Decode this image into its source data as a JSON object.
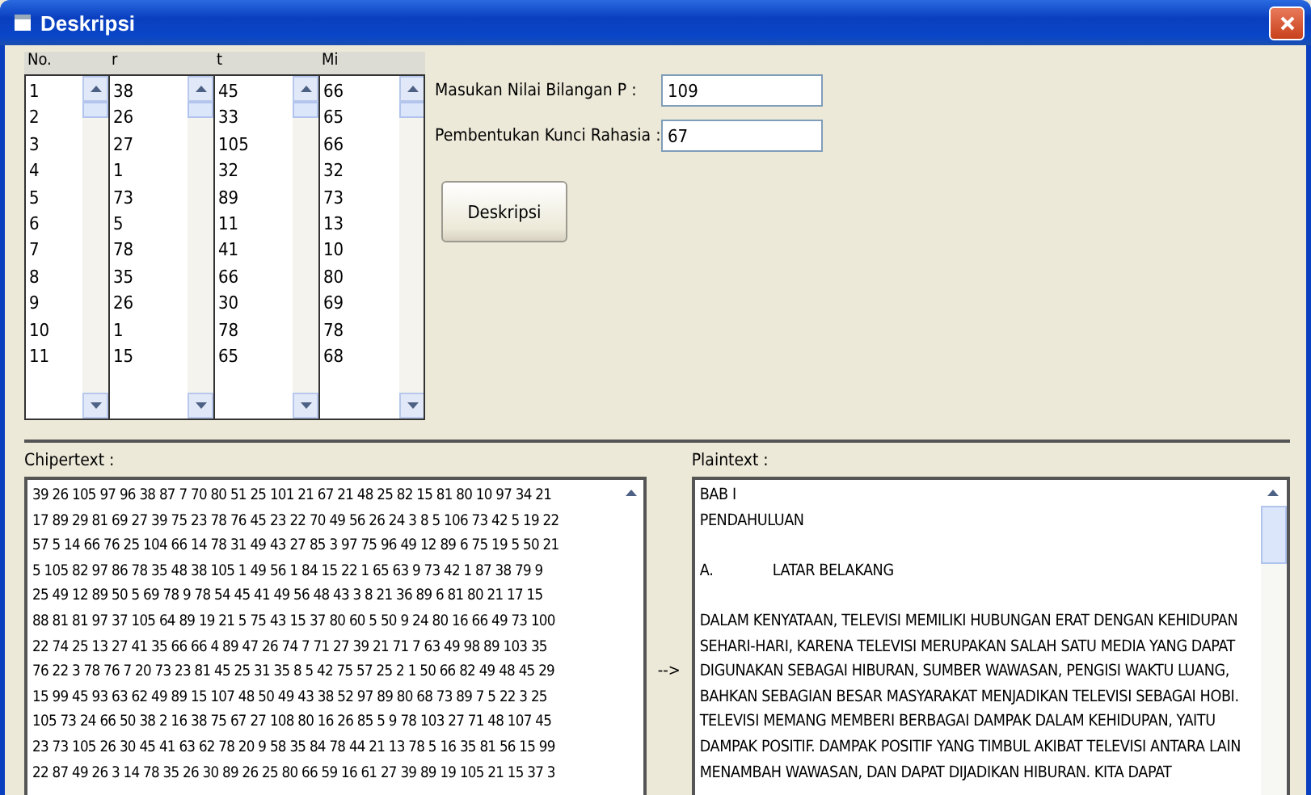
{
  "window": {
    "title": "Deskripsi"
  },
  "table": {
    "columns": [
      {
        "header": "No.",
        "values": [
          "1",
          "2",
          "3",
          "4",
          "5",
          "6",
          "7",
          "8",
          "9",
          "10",
          "11"
        ]
      },
      {
        "header": "r",
        "values": [
          "38",
          "26",
          "27",
          "1",
          "73",
          "5",
          "78",
          "35",
          "26",
          "1",
          "15"
        ]
      },
      {
        "header": "t",
        "values": [
          "45",
          "33",
          "105",
          "32",
          "89",
          "11",
          "41",
          "66",
          "30",
          "78",
          "65"
        ]
      },
      {
        "header": "Mi",
        "values": [
          "66",
          "65",
          "66",
          "32",
          "73",
          "13",
          "10",
          "80",
          "69",
          "78",
          "68"
        ]
      }
    ]
  },
  "fields": [
    {
      "label": "Masukan Nilai Bilangan P :",
      "value": "109"
    },
    {
      "label": "Pembentukan Kunci Rahasia :",
      "value": "67"
    }
  ],
  "button": "Deskripsi",
  "chipertext": {
    "label": "Chipertext :",
    "lines": [
      "39 26 105 97 96 38 87 7 70 80 51 25 101 21 67 21 48 25 82 15 81 80 10 97 34 21",
      "17 89 29 81 69 27 39 75 23 78 76 45 23 22 70 49 56 26 24 3 8 5 106 73 42 5 19 22",
      "57 5 14 66 76 25 104 66 14 78 31 49 43 27 85 3 97 75 96 49 12 89 6 75 19 5 50 21",
      "5 105 82 97 86 78 35 48 38 105 1 49 56 1 84 15 22 1 65 63 9 73 42 1 87 38 79 9",
      "25 49 12 89 50 5 69 78 9 78 54 45 41 49 56 48 43 3 8 21 36 89 6 81 80 21 17 15",
      "88 81 81 97 37 105 64 89 19 21 5 75 43 15 37 80 60 5 50 9 24 80 16 66 49 73 100",
      "22 74 25 13 27 41 35 66 66 4 89 47 26 74 7 71 27 39 21 71 7 63 49 98 89 103 35",
      "76 22 3 78 76 7 20 73 23 81 45 25 31 35 8 5 42 75 57 25 2 1 50 66 82 49 48 45 29",
      "15 99 45 93 63 62 49 89 15 107 48 50 49 43 38 52 97 89 80 68 73 89 7 5 22 3 25",
      "105 73 24 66 50 38 2 16 38 75 67 27 108 80 16 26 85 5 9 78 103 27 71 48 107 45",
      "23 73 105 26 30 45 41 63 62 78 20 9 58 35 84 78 44 21 13 78 5 16 35 81 56 15 99",
      "22 87 49 26 3 14 78 35 26 30 89 26 25 80 66 59 16 61 27 39 89 19 105 21 15 37 3"
    ]
  },
  "arrow": "-->",
  "plaintext": {
    "label": "Plaintext :",
    "blocks": [
      {
        "lines": [
          "BAB I",
          "PENDAHULUAN"
        ]
      },
      {
        "marker": "A.",
        "lines": [
          "LATAR BELAKANG"
        ]
      },
      {
        "lines": [
          "DALAM KENYATAAN, TELEVISI MEMILIKI HUBUNGAN ERAT DENGAN KEHIDUPAN",
          "SEHARI-HARI, KARENA TELEVISI MERUPAKAN SALAH SATU MEDIA YANG DAPAT",
          "DIGUNAKAN SEBAGAI HIBURAN, SUMBER WAWASAN, PENGISI WAKTU LUANG,",
          "BAHKAN SEBAGIAN BESAR MASYARAKAT MENJADIKAN TELEVISI SEBAGAI HOBI.",
          "TELEVISI MEMANG MEMBERI BERBAGAI DAMPAK DALAM KEHIDUPAN, YAITU",
          "DAMPAK POSITIF. DAMPAK POSITIF YANG TIMBUL AKIBAT TELEVISI ANTARA LAIN",
          "MENAMBAH WAWASAN, DAN DAPAT DIJADIKAN HIBURAN. KITA DAPAT"
        ]
      }
    ]
  }
}
